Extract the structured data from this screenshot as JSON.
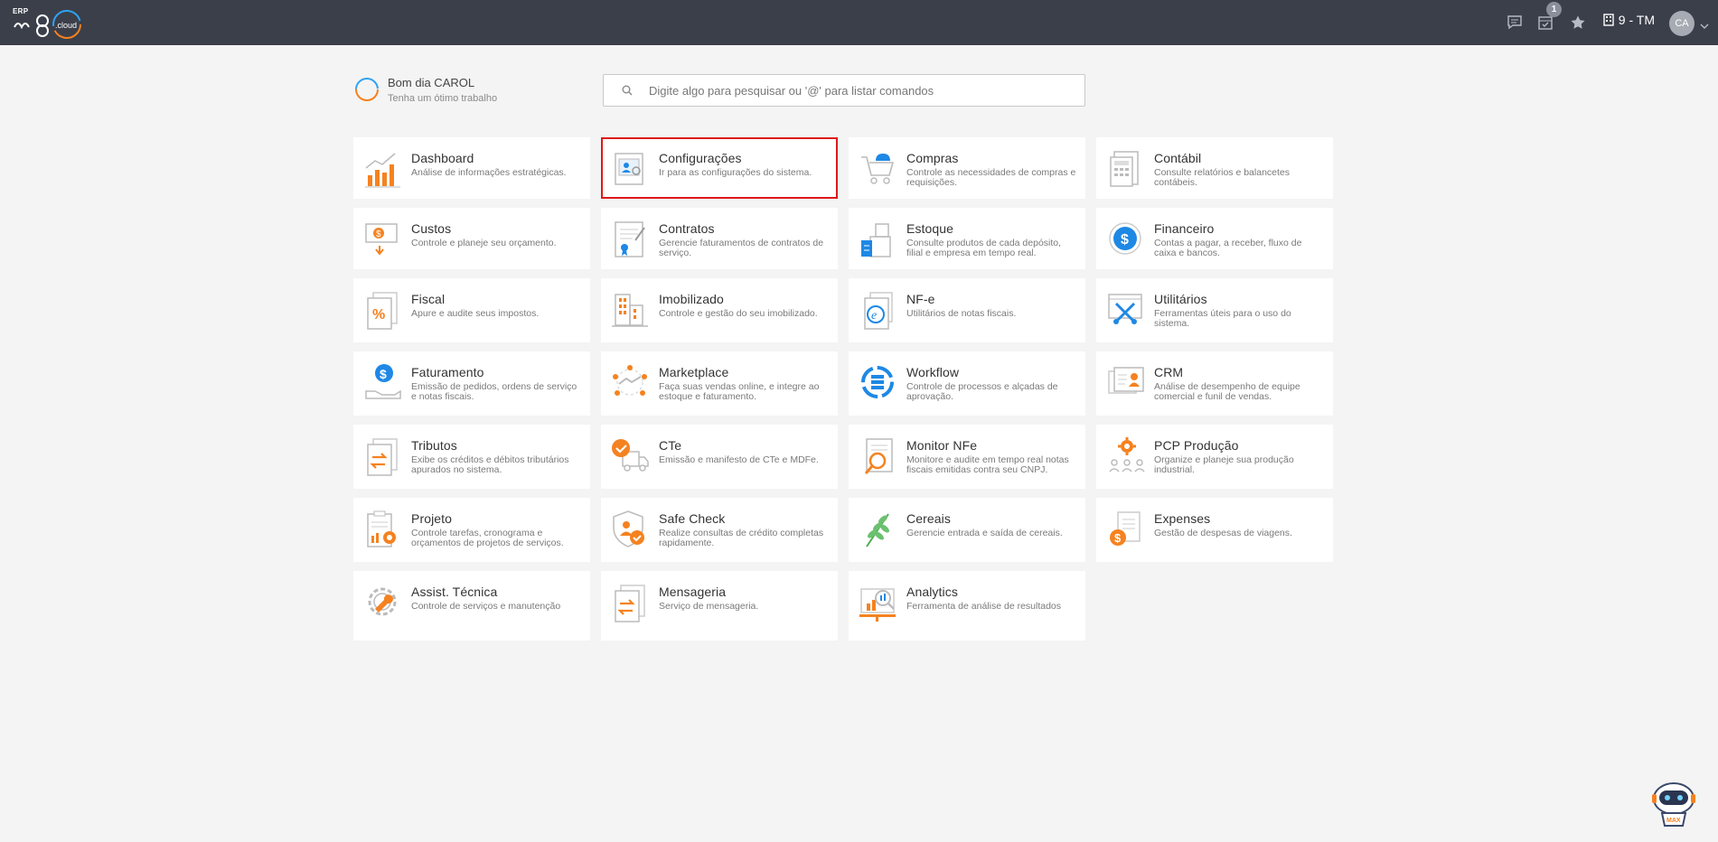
{
  "header": {
    "logo_prefix": "ERP",
    "logo_text": "m8.cloud",
    "tasks_badge": "1",
    "company": "9 - TM",
    "user_initials": "CA"
  },
  "greeting": {
    "title": "Bom dia CAROL",
    "subtitle": "Tenha um ótimo trabalho"
  },
  "search": {
    "placeholder": "Digite algo para pesquisar ou '@' para listar comandos"
  },
  "modules": [
    {
      "name": "Dashboard",
      "desc": "Análise de informações estratégicas."
    },
    {
      "name": "Configurações",
      "desc": "Ir para as configurações do sistema."
    },
    {
      "name": "Compras",
      "desc": "Controle as necessidades de compras e requisições."
    },
    {
      "name": "Contábil",
      "desc": "Consulte relatórios e balancetes contábeis."
    },
    {
      "name": "Custos",
      "desc": "Controle e planeje seu orçamento."
    },
    {
      "name": "Contratos",
      "desc": "Gerencie faturamentos de contratos de serviço."
    },
    {
      "name": "Estoque",
      "desc": "Consulte produtos de cada depósito, filial e empresa em tempo real."
    },
    {
      "name": "Financeiro",
      "desc": "Contas a pagar, a receber, fluxo de caixa e bancos."
    },
    {
      "name": "Fiscal",
      "desc": "Apure e audite seus impostos."
    },
    {
      "name": "Imobilizado",
      "desc": "Controle e gestão do seu imobilizado."
    },
    {
      "name": "NF-e",
      "desc": "Utilitários de notas fiscais."
    },
    {
      "name": "Utilitários",
      "desc": "Ferramentas úteis para o uso do sistema."
    },
    {
      "name": "Faturamento",
      "desc": "Emissão de pedidos, ordens de serviço e notas fiscais."
    },
    {
      "name": "Marketplace",
      "desc": "Faça suas vendas online, e integre ao estoque e faturamento."
    },
    {
      "name": "Workflow",
      "desc": "Controle de processos e alçadas de aprovação."
    },
    {
      "name": "CRM",
      "desc": "Análise de desempenho de equipe comercial e funil de vendas."
    },
    {
      "name": "Tributos",
      "desc": "Exibe os créditos e débitos tributários apurados no sistema."
    },
    {
      "name": "CTe",
      "desc": "Emissão e manifesto de CTe e MDFe."
    },
    {
      "name": "Monitor NFe",
      "desc": "Monitore e audite em tempo real notas fiscais emitidas contra seu CNPJ."
    },
    {
      "name": "PCP Produção",
      "desc": "Organize e planeje sua produção industrial."
    },
    {
      "name": "Projeto",
      "desc": "Controle tarefas, cronograma e orçamentos de projetos de serviços."
    },
    {
      "name": "Safe Check",
      "desc": "Realize consultas de crédito completas rapidamente."
    },
    {
      "name": "Cereais",
      "desc": "Gerencie entrada e saída de cereais."
    },
    {
      "name": "Expenses",
      "desc": "Gestão de despesas de viagens."
    },
    {
      "name": "Assist. Técnica",
      "desc": "Controle de serviços e manutenção"
    },
    {
      "name": "Mensageria",
      "desc": "Serviço de mensageria."
    },
    {
      "name": "Analytics",
      "desc": "Ferramenta de análise de resultados"
    }
  ],
  "robot_label": "MAX",
  "colors": {
    "topbar": "#3b3f4a",
    "accent_orange": "#f58220",
    "accent_blue": "#1e88e5",
    "selected_border": "#e01818"
  }
}
